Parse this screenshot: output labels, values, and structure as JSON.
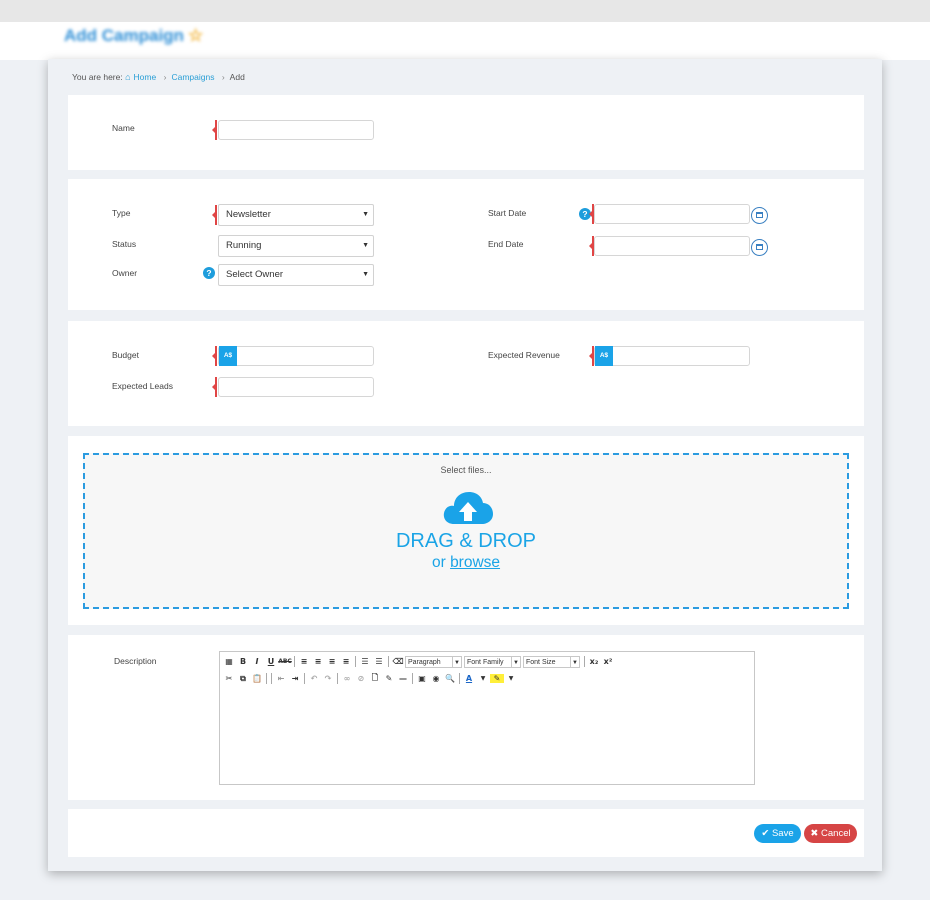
{
  "page": {
    "title": "Add Campaign"
  },
  "breadcrumb": {
    "prefix": "You are here:",
    "home": "Home",
    "campaigns": "Campaigns",
    "current": "Add",
    "sep1": "›",
    "sep2": "›"
  },
  "name_section": {
    "name_label": "Name",
    "name_value": ""
  },
  "details": {
    "type_label": "Type",
    "type_value": "Newsletter",
    "status_label": "Status",
    "status_value": "Running",
    "owner_label": "Owner",
    "owner_value": "Select Owner",
    "start_label": "Start Date",
    "start_value": "",
    "end_label": "End Date",
    "end_value": ""
  },
  "finance": {
    "budget_label": "Budget",
    "currency": "A$",
    "revenue_label": "Expected Revenue",
    "leads_label": "Expected Leads"
  },
  "upload": {
    "select_files": "Select files...",
    "drag_drop": "DRAG & DROP",
    "or_text": "or",
    "browse": "browse"
  },
  "description": {
    "label": "Description",
    "paragraph": "Paragraph",
    "font_family": "Font Family",
    "font_size": "Font Size"
  },
  "actions": {
    "save": "Save",
    "cancel": "Cancel"
  },
  "colors": {
    "accent": "#1aa3e8",
    "danger": "#d64545",
    "required": "#e04545"
  }
}
